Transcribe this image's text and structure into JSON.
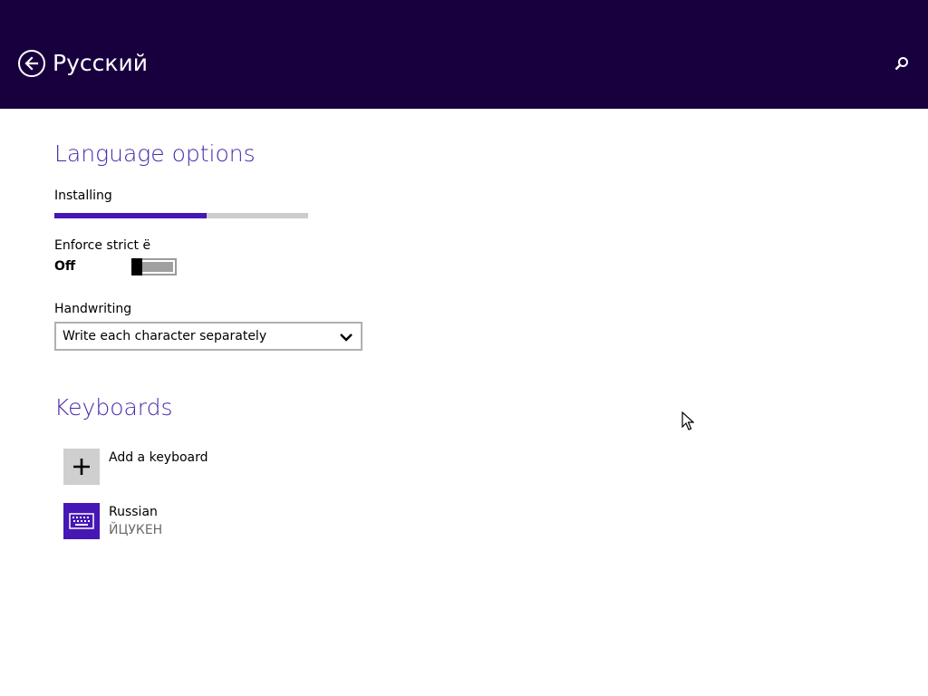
{
  "header": {
    "title": "Русский",
    "background": "#18003f",
    "back_icon": "back-arrow-circle-icon",
    "search_icon": "search-icon"
  },
  "language_options": {
    "title": "Language options",
    "installing_label": "Installing",
    "install_progress": 0.6,
    "enforce_label": "Enforce strict ё",
    "enforce_state": "Off",
    "enforce_on": false,
    "handwriting_label": "Handwriting",
    "handwriting_value": "Write each character separately"
  },
  "keyboards": {
    "title": "Keyboards",
    "add_label": "Add a keyboard",
    "items": [
      {
        "name": "Russian",
        "layout": "ЙЦУКЕН",
        "icon": "keyboard-icon"
      }
    ]
  },
  "accent_color": "#4617b4",
  "title_color": "#4a2aa8"
}
